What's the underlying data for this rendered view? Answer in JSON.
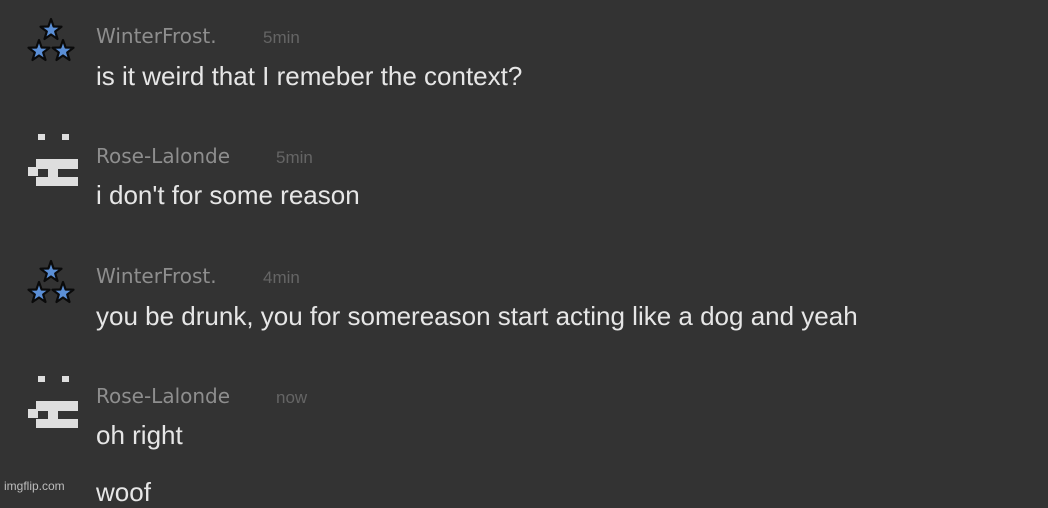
{
  "messages": [
    {
      "avatar": "three-stars-icon",
      "username": "WinterFrost.",
      "time": "5min",
      "text": "is it weird that I remeber the context?"
    },
    {
      "avatar": "pixel-face-icon",
      "username": "Rose-Lalonde",
      "time": "5min",
      "text": "i don't for some reason"
    },
    {
      "avatar": "three-stars-icon",
      "username": "WinterFrost.",
      "time": "4min",
      "text": "you be drunk, you for somereason start acting like a dog and yeah"
    },
    {
      "avatar": "pixel-face-icon",
      "username": "Rose-Lalonde",
      "time": "now",
      "text": "oh right"
    },
    {
      "text": "woof"
    }
  ],
  "watermark": "imgflip.com",
  "colors": {
    "background": "#333333",
    "username": "#8e8e8e",
    "timestamp": "#656565",
    "message_text": "#e6e6e6",
    "star_fill": "#5b8fd6",
    "pixel_face": "#dedede"
  }
}
